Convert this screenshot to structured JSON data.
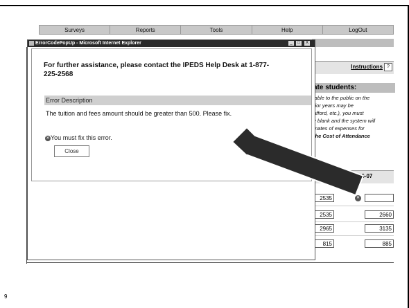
{
  "slide": {
    "number": "9"
  },
  "nav": [
    "Surveys",
    "Reports",
    "Tools",
    "Help",
    "LogOut"
  ],
  "page": {
    "instructions_link": "Instructions",
    "help_icon_glyph": "?",
    "section_heading": "ate students:",
    "body_lines": [
      "lable to the public on the",
      "rior years may be",
      "afford, etc.), you must",
      "y blank and the system will",
      "mates of expenses for"
    ],
    "body_bold_line": "the Cost of Attendance",
    "year_header": "2006-07",
    "rows": [
      {
        "prior": "2535",
        "current": "",
        "error": true
      },
      {
        "prior": "2535",
        "current": "2660",
        "error": false
      },
      {
        "prior": "2965",
        "current": "3135",
        "error": false
      },
      {
        "prior": "815",
        "current": "885",
        "error": false
      }
    ]
  },
  "popup": {
    "title": "ErrorCodePopUp - Microsoft Internet Explorer",
    "buttons": {
      "minimize": "_",
      "maximize": "□",
      "close": "X"
    },
    "assistance_text": "For further assistance, please contact the IPEDS Help Desk at 1-877-225-2568",
    "error_description_label": "Error Description",
    "error_message": "The tuition and fees amount should be greater than 500. Please fix.",
    "must_fix_text": "You must fix this error.",
    "close_label": "Close",
    "error_icon_glyph": "✕"
  },
  "colors": {
    "arrow": "#2b2b2b",
    "titlebar": "#2a2a2a",
    "header_bar": "#cfcfcf"
  }
}
